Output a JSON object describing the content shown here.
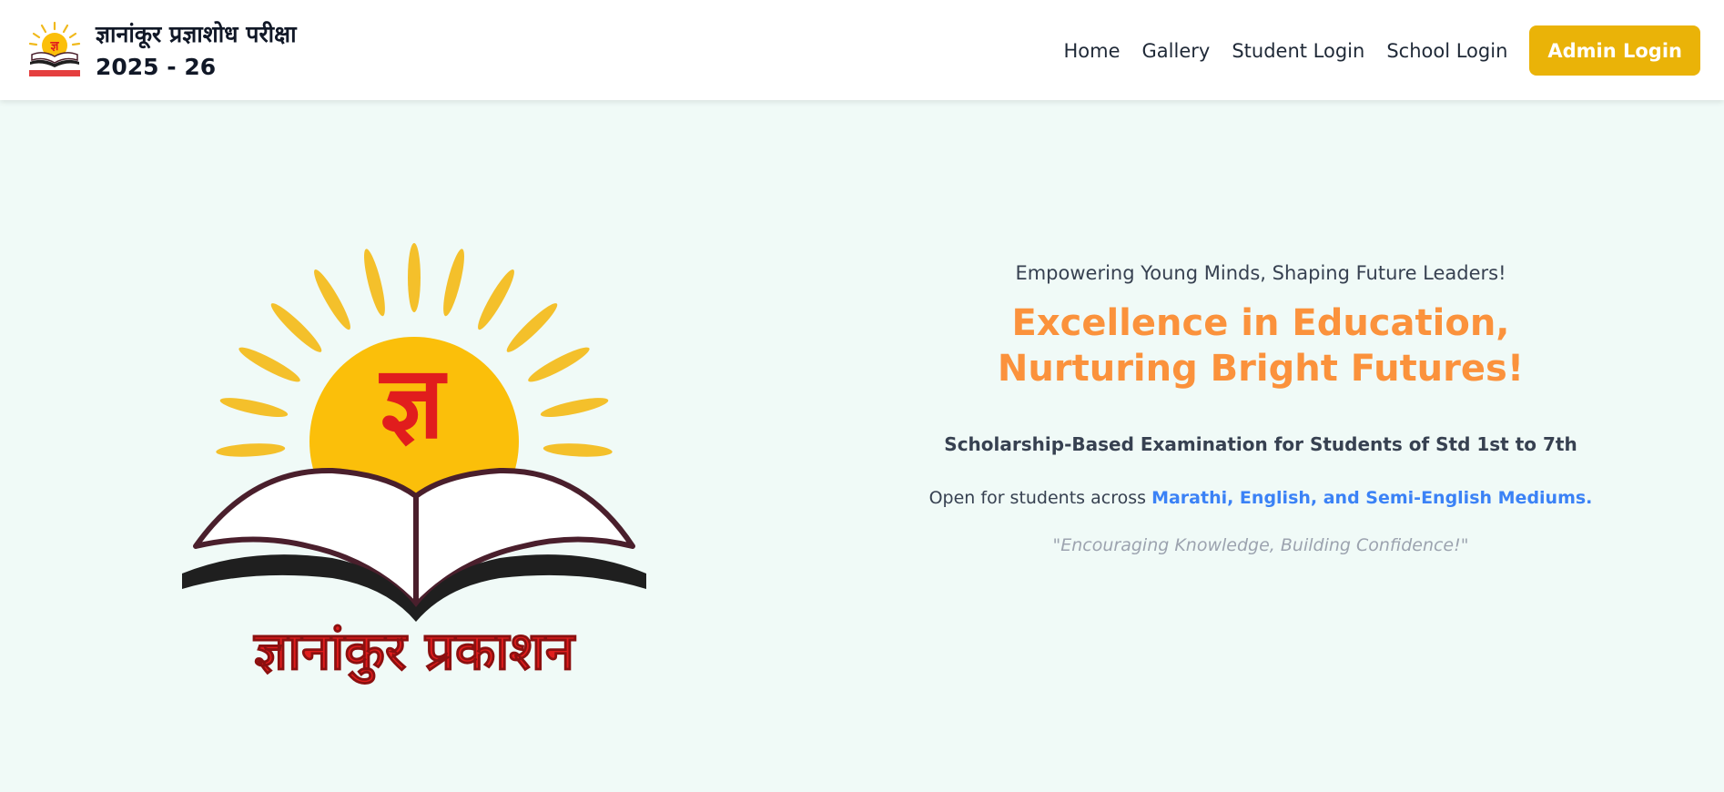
{
  "brand": {
    "title": "ज्ञानांकूर प्रज्ञाशोध परीक्षा",
    "year": "2025 - 26",
    "logo_text": "ज्ञानांकुर प्रकाशन",
    "logo_glyph": "ज्ञ"
  },
  "nav": {
    "home": "Home",
    "gallery": "Gallery",
    "student_login": "Student Login",
    "school_login": "School Login",
    "admin_login": "Admin Login"
  },
  "hero": {
    "tagline": "Empowering Young Minds, Shaping Future Leaders!",
    "headline_line1": "Excellence in Education,",
    "headline_line2": "Nurturing Bright Futures!",
    "subheading": "Scholarship-Based Examination for Students of Std 1st to 7th",
    "mediums_prefix": "Open for students across ",
    "mediums_highlight": "Marathi, English, and Semi-English Mediums.",
    "quote": "\"Encouraging Knowledge, Building Confidence!\""
  },
  "colors": {
    "accent_yellow": "#eab308",
    "headline_orange": "#fb923c",
    "link_blue": "#3b82f6",
    "logo_red": "#e11d1d",
    "sun_gold": "#fbbf0a",
    "book_maroon": "#4a1f2c"
  },
  "icons": {
    "brand_logo": "gyanankur-logo-icon",
    "hero_logo": "gyanankur-prakashan-logo"
  }
}
